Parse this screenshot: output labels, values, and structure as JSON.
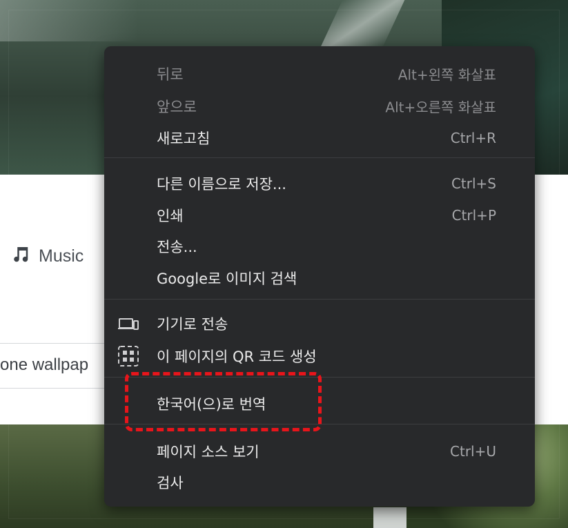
{
  "background": {
    "music_label": "Music",
    "search_text": "one wallpap"
  },
  "menu": {
    "back": {
      "label": "뒤로",
      "shortcut": "Alt+왼쪽 화살표"
    },
    "forward": {
      "label": "앞으로",
      "shortcut": "Alt+오른쪽 화살표"
    },
    "reload": {
      "label": "새로고침",
      "shortcut": "Ctrl+R"
    },
    "save_as": {
      "label": "다른 이름으로 저장...",
      "shortcut": "Ctrl+S"
    },
    "print": {
      "label": "인쇄",
      "shortcut": "Ctrl+P"
    },
    "cast": {
      "label": "전송..."
    },
    "google_image": {
      "label": "Google로 이미지 검색"
    },
    "send_to_device": {
      "label": "기기로 전송"
    },
    "qr_code": {
      "label": "이 페이지의 QR 코드 생성"
    },
    "translate": {
      "label": "한국어(으)로 번역"
    },
    "view_source": {
      "label": "페이지 소스 보기",
      "shortcut": "Ctrl+U"
    },
    "inspect": {
      "label": "검사"
    }
  },
  "colors": {
    "menu_bg": "#28292b",
    "highlight": "#e8151b"
  },
  "icons": {
    "music": "music-note-icon",
    "send_to_device": "devices-icon",
    "qr_code": "qr-code-icon"
  }
}
